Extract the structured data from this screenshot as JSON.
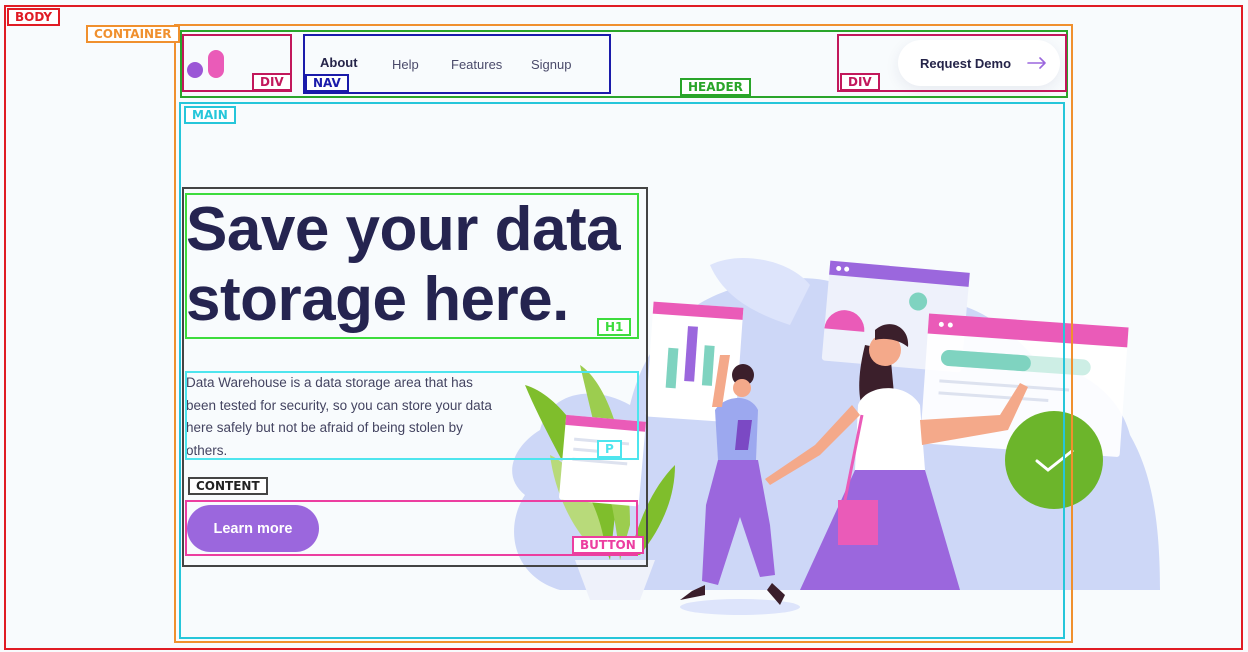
{
  "debug_labels": {
    "body": "BODY",
    "container": "CONTAINER",
    "header": "HEADER",
    "logo_div": "DIV",
    "nav": "NAV",
    "cta_div": "DIV",
    "main": "MAIN",
    "h1": "H1",
    "p": "P",
    "content": "CONTENT",
    "button": "BUTTON"
  },
  "debug_colors": {
    "body": "#e01b24",
    "container": "#f0902e",
    "header": "#2aa52a",
    "div": "#c2185b",
    "nav": "#1b1baa",
    "main": "#26c6da",
    "h1": "#3ddc3d",
    "p": "#4ee5ee",
    "content": "#444444",
    "button": "#ec3ea0"
  },
  "nav": {
    "items": [
      "About",
      "Help",
      "Features",
      "Signup"
    ]
  },
  "cta": {
    "label": "Request Demo",
    "icon": "arrow-right-icon"
  },
  "hero": {
    "title_line1": "Save your data",
    "title_line2": "storage here.",
    "description": "Data Warehouse is a data storage area that has been  tested for security, so you can store your data here  safely but not be afraid of being stolen by others.",
    "button_label": "Learn more"
  },
  "colors": {
    "brand_purple": "#9b67dd",
    "brand_pink": "#ea5bb8",
    "heading": "#252450",
    "success_green": "#6cb52b"
  }
}
